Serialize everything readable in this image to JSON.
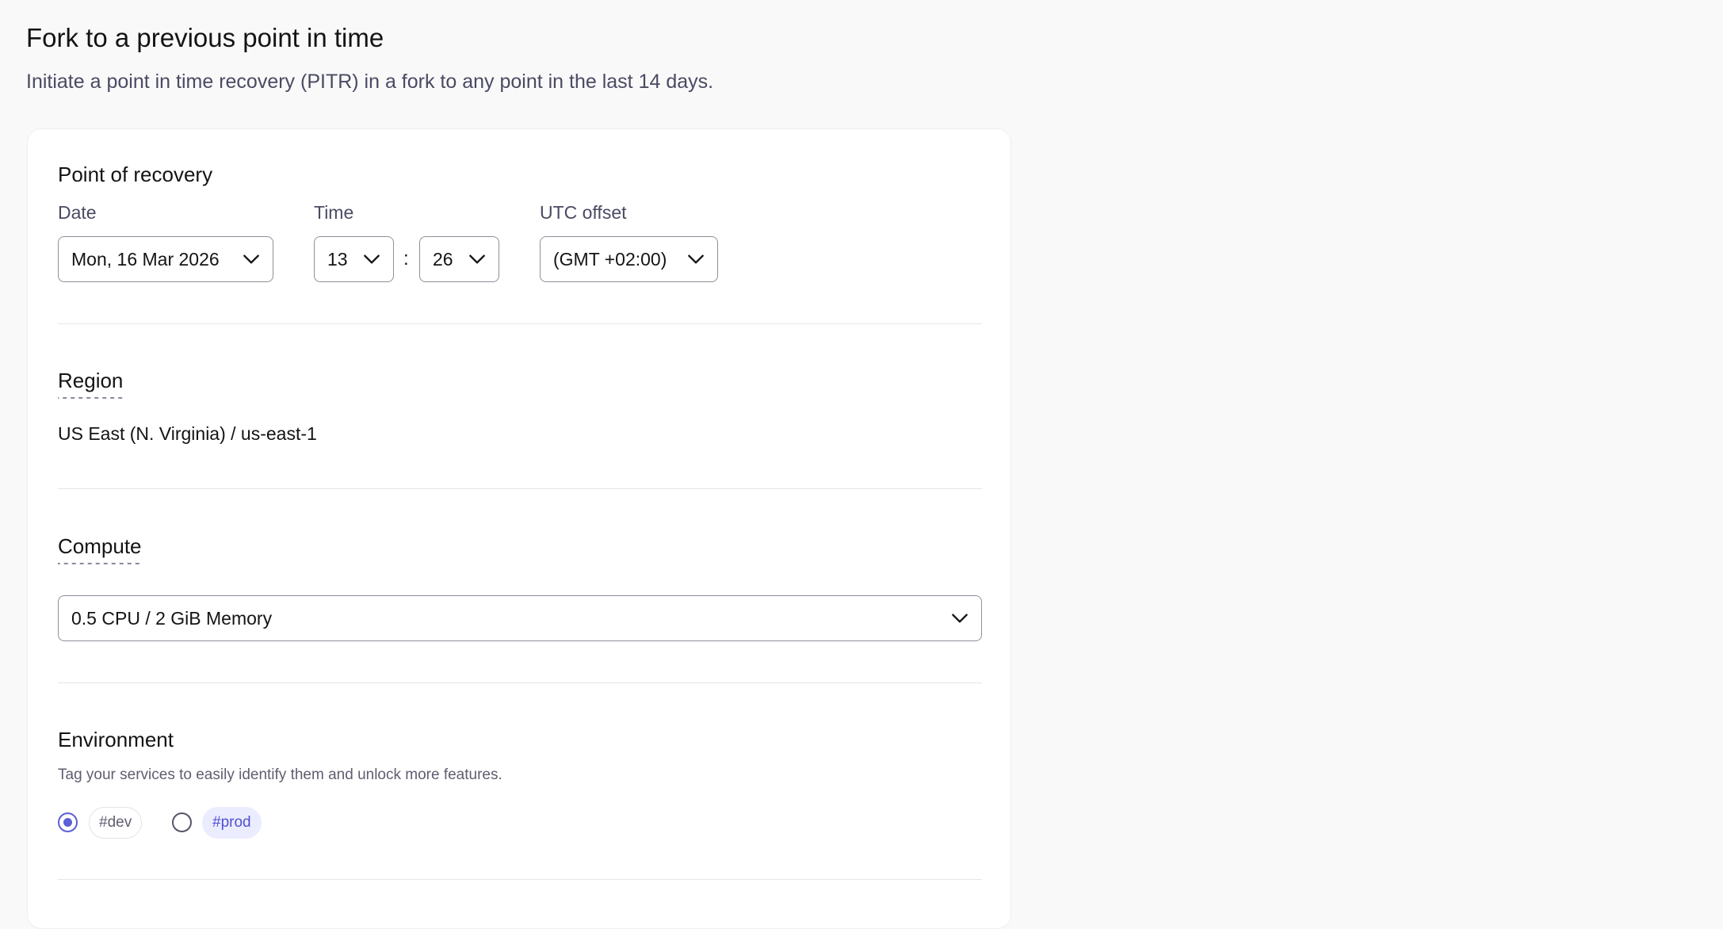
{
  "header": {
    "title": "Fork to a previous point in time",
    "subtitle": "Initiate a point in time recovery (PITR) in a fork to any point in the last 14 days."
  },
  "recovery": {
    "title": "Point of recovery",
    "date_label": "Date",
    "date_value": "Mon, 16 Mar 2026",
    "time_label": "Time",
    "hour_value": "13",
    "separator": ":",
    "minute_value": "26",
    "utc_label": "UTC offset",
    "utc_value": "(GMT +02:00)"
  },
  "region": {
    "title": "Region",
    "value": "US East (N. Virginia) / us-east-1"
  },
  "compute": {
    "title": "Compute",
    "value": "0.5 CPU / 2 GiB Memory"
  },
  "environment": {
    "title": "Environment",
    "helper": "Tag your services to easily identify them and unlock more features.",
    "options": [
      {
        "label": "#dev",
        "selected": true
      },
      {
        "label": "#prod",
        "selected": false
      }
    ]
  },
  "colors": {
    "accent": "#5a5fd6",
    "prod_tag_bg": "#ececff",
    "prod_tag_text": "#4f4fd0",
    "page_bg": "#f9f9f9",
    "card_bg": "#ffffff"
  }
}
